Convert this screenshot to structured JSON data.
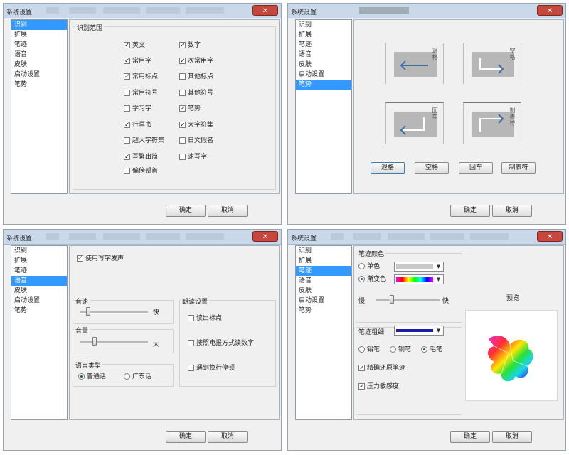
{
  "window_title": "系统设置",
  "close_glyph": "✕",
  "sidebar_items": [
    "识别",
    "扩展",
    "笔迹",
    "语音",
    "皮肤",
    "启动设置",
    "笔势"
  ],
  "footer": {
    "ok": "确定",
    "cancel": "取消"
  },
  "recognize": {
    "group_title": "识别范围",
    "left": [
      {
        "label": "英文",
        "checked": true
      },
      {
        "label": "常用字",
        "checked": true
      },
      {
        "label": "常用标点",
        "checked": true
      },
      {
        "label": "常用符号",
        "checked": false
      },
      {
        "label": "学习字",
        "checked": false
      },
      {
        "label": "行草书",
        "checked": true
      },
      {
        "label": "超大字符集",
        "checked": false
      },
      {
        "label": "写繁出简",
        "checked": true
      },
      {
        "label": "偏傍部首",
        "checked": false
      }
    ],
    "right": [
      {
        "label": "数字",
        "checked": true
      },
      {
        "label": "次常用字",
        "checked": true
      },
      {
        "label": "其他标点",
        "checked": false
      },
      {
        "label": "其他符号",
        "checked": false
      },
      {
        "label": "笔势",
        "checked": true
      },
      {
        "label": "大字符集",
        "checked": true
      },
      {
        "label": "日文假名",
        "checked": false
      },
      {
        "label": "速写字",
        "checked": false
      }
    ]
  },
  "gesture": {
    "tiles": [
      {
        "vlabel": "退格",
        "icon": "arrow-left-icon"
      },
      {
        "vlabel": "空格",
        "icon": "space-arrow-icon"
      },
      {
        "vlabel": "回车",
        "icon": "enter-arrow-icon"
      },
      {
        "vlabel": "制表符",
        "icon": "tab-arrow-icon"
      }
    ],
    "buttons": [
      "退格",
      "空格",
      "回车",
      "制表符"
    ]
  },
  "voice": {
    "enable_label": "使用写字发声",
    "enable_checked": true,
    "speed_label": "音速",
    "speed_end": "快",
    "speed_value": 0.12,
    "volume_label": "音量",
    "volume_end": "大",
    "volume_value": 0.22,
    "lang_title": "语言类型",
    "lang_options": [
      {
        "label": "普通话",
        "selected": true
      },
      {
        "label": "广东话",
        "selected": false
      }
    ],
    "read_title": "朗读设置",
    "read_options": [
      {
        "label": "读出标点",
        "checked": false
      },
      {
        "label": "按照电报方式读数字",
        "checked": false
      },
      {
        "label": "遇到换行停顿",
        "checked": false
      }
    ]
  },
  "ink": {
    "color_title": "笔迹颜色",
    "single_label": "单色",
    "gradient_label": "渐变色",
    "gradient_selected": true,
    "slow_label": "慢",
    "fast_label": "快",
    "speed_value": 0.25,
    "thickness_label": "笔迹粗细",
    "pen_options": [
      {
        "label": "铅笔",
        "selected": false
      },
      {
        "label": "钢笔",
        "selected": false
      },
      {
        "label": "毛笔",
        "selected": true
      }
    ],
    "restore_label": "精确还原笔迹",
    "restore_checked": true,
    "pressure_label": "压力敏感度",
    "pressure_checked": true,
    "preview_label": "预览",
    "colors": {
      "selection": "#3399ff",
      "title": "#c9d9ea",
      "close": "#c8473d"
    }
  }
}
